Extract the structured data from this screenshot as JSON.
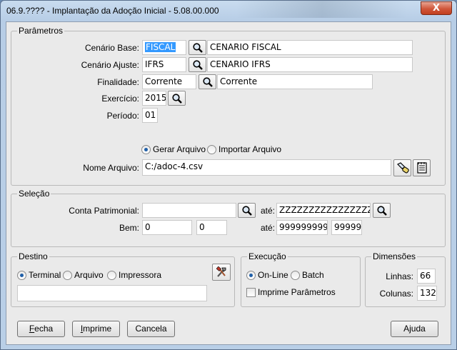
{
  "window": {
    "title": "06.9.???? - Implantação da Adoção Inicial - 5.08.00.000",
    "close_label": "X"
  },
  "parametros": {
    "legend": "Parâmetros",
    "cenario_base": {
      "label": "Cenário Base:",
      "value": "FISCAL",
      "desc": "CENARIO FISCAL"
    },
    "cenario_ajuste": {
      "label": "Cenário Ajuste:",
      "value": "IFRS",
      "desc": "CENARIO IFRS"
    },
    "finalidade": {
      "label": "Finalidade:",
      "value": "Corrente",
      "desc": "Corrente"
    },
    "exercicio": {
      "label": "Exercício:",
      "value": "2015"
    },
    "periodo": {
      "label": "Período:",
      "value": "01"
    },
    "modo": {
      "gerar_label": "Gerar Arquivo",
      "importar_label": "Importar Arquivo",
      "selected": "gerar"
    },
    "nome_arquivo": {
      "label": "Nome Arquivo:",
      "value": "C:/adoc-4.csv"
    }
  },
  "selecao": {
    "legend": "Seleção",
    "conta_label": "Conta Patrimonial:",
    "conta_from": "",
    "ate_label": "até:",
    "conta_to": "ZZZZZZZZZZZZZZZZ",
    "bem_label": "Bem:",
    "bem_from_1": "0",
    "bem_from_2": "0",
    "bem_to_1": "999999999",
    "bem_to_2": "99999"
  },
  "destino": {
    "legend": "Destino",
    "options": [
      "Terminal",
      "Arquivo",
      "Impressora"
    ],
    "selected": "Terminal",
    "field_value": ""
  },
  "execucao": {
    "legend": "Execução",
    "options": [
      "On-Line",
      "Batch"
    ],
    "selected": "On-Line",
    "imprime_label": "Imprime Parâmetros",
    "imprime_checked": false
  },
  "dimensoes": {
    "legend": "Dimensões",
    "linhas_label": "Linhas:",
    "linhas": "66",
    "colunas_label": "Colunas:",
    "colunas": "132"
  },
  "buttons": {
    "fecha": {
      "first": "F",
      "rest": "echa"
    },
    "imprime": {
      "first": "I",
      "rest": "mprime"
    },
    "cancela": "Cancela",
    "ajuda": "Ajuda"
  },
  "colors": {
    "selection": "#3399ff",
    "radio_dot": "#1f5fa8",
    "close_button": "#d0563a"
  }
}
